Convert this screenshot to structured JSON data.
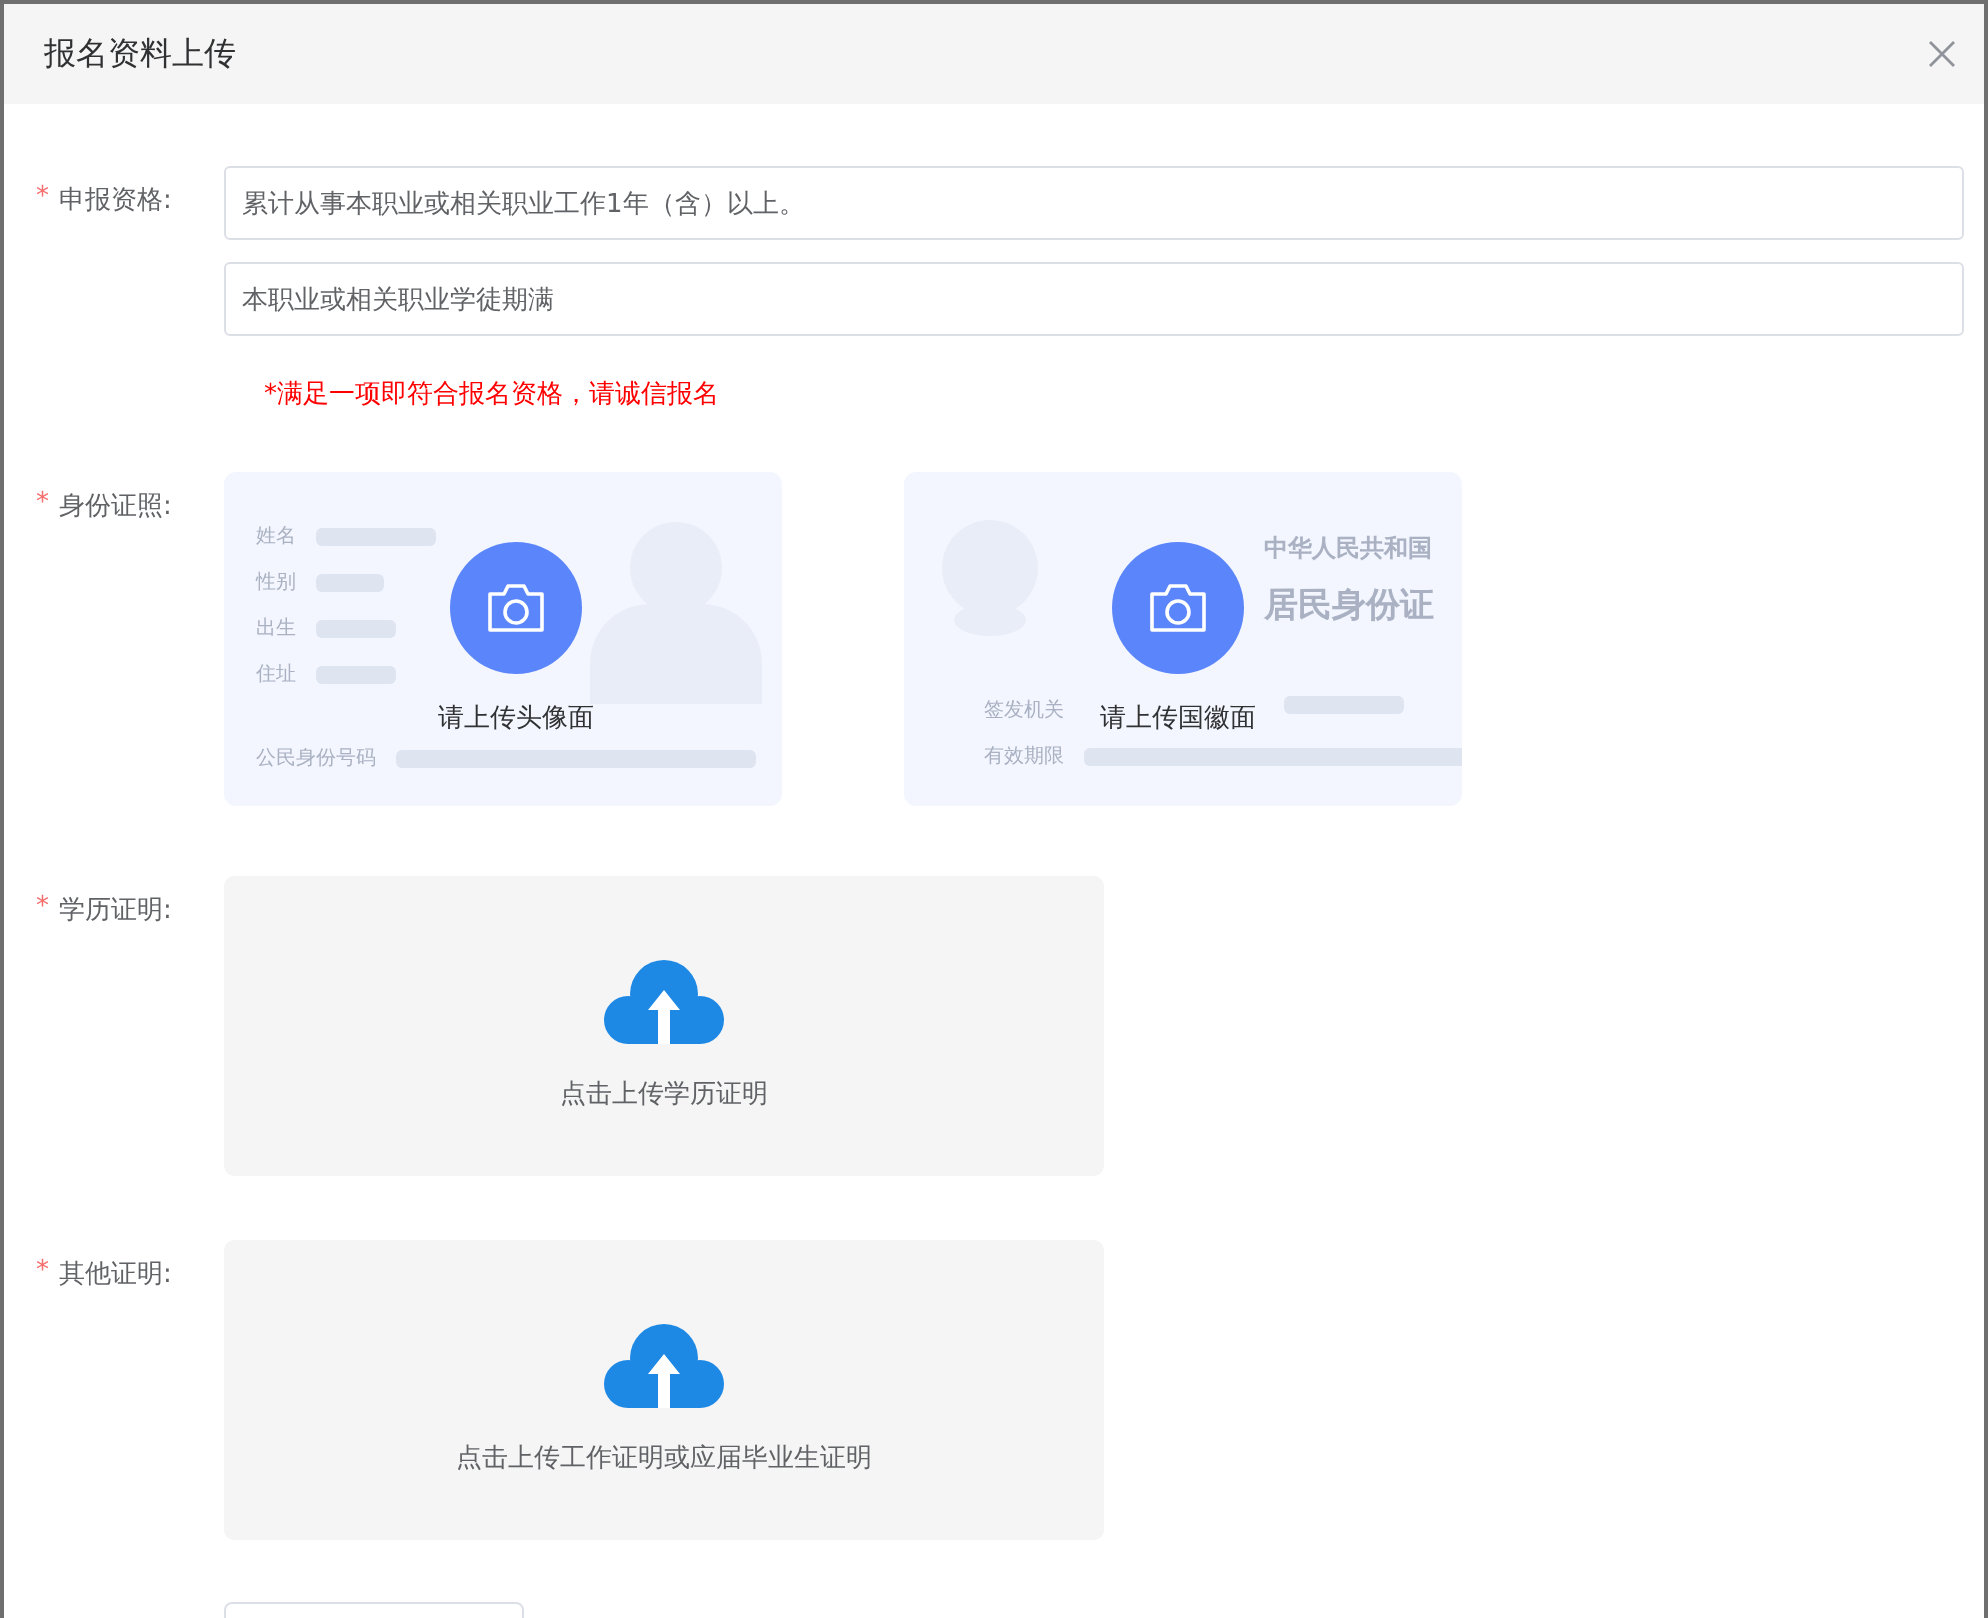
{
  "dialog": {
    "title": "报名资料上传"
  },
  "fields": [
    {
      "kind": "inputs",
      "marker": "*",
      "label": "申报资格:",
      "values": [
        "累计从事本职业或相关职业工作1年（含）以上。",
        "本职业或相关职业学徒期满"
      ],
      "hint": "*满足一项即符合报名资格，请诚信报名"
    },
    {
      "kind": "id_cards",
      "marker": "*",
      "label": "身份证照:",
      "cards": [
        {
          "kind": "front",
          "caption": "请上传头像面",
          "rows": [
            "姓名",
            "性别",
            "出生",
            "住址"
          ],
          "number_label": "公民身份号码"
        },
        {
          "kind": "back",
          "caption": "请上传国徽面",
          "title": "中华人民共和国",
          "subtitle": "居民身份证",
          "rows": [
            "签发机关",
            "有效期限"
          ]
        }
      ]
    },
    {
      "kind": "upload",
      "marker": "*",
      "label": "学历证明:",
      "caption": "点击上传学历证明"
    },
    {
      "kind": "upload",
      "marker": "*",
      "label": "其他证明:",
      "caption": "点击上传工作证明或应届毕业生证明"
    },
    {
      "kind": "cut_button"
    }
  ]
}
